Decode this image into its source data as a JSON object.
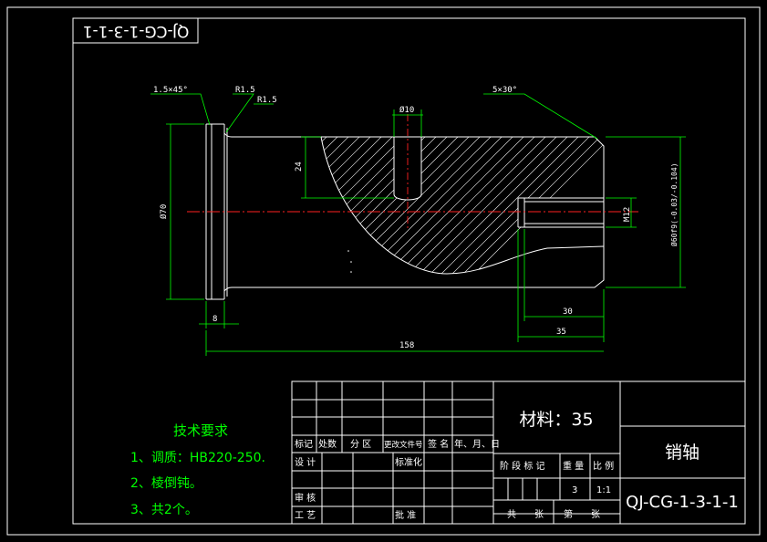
{
  "drawing_number_flipped": "QJ-CG-1-3-1-1",
  "dimensions": {
    "chamfer": "1.5×45°",
    "r1": "R1.5",
    "r2": "R1.5",
    "phi10": "Ø10",
    "chamfer2": "5×30°",
    "d24": "24",
    "phi70": "Ø70",
    "m12": "M12",
    "phi60": "Ø60f9(-0.03/-0.104)",
    "d8": "8",
    "d30": "30",
    "d35": "35",
    "d158": "158"
  },
  "tech_requirements": {
    "title": "技术要求",
    "items": [
      "1、调质：HB220-250.",
      "2、棱倒钝。",
      "3、共2个。"
    ]
  },
  "title_block": {
    "material": "材料：35",
    "part_name": "销轴",
    "drawing_number": "QJ-CG-1-3-1-1",
    "headers": {
      "mark": "标记",
      "count": "处数",
      "zone": "分 区",
      "change_doc": "更改文件号",
      "sign": "签 名",
      "date": "年、月、日"
    },
    "design": "设 计",
    "standardize": "标准化",
    "review": "审 核",
    "process": "工 艺",
    "approve": "批 准",
    "stage_mark": "阶 段 标 记",
    "weight": "重 量",
    "scale_label": "比 例",
    "weight_value": "3",
    "scale_value": "1:1",
    "sheets_total": "共　　张",
    "sheet_no": "第　　张"
  }
}
